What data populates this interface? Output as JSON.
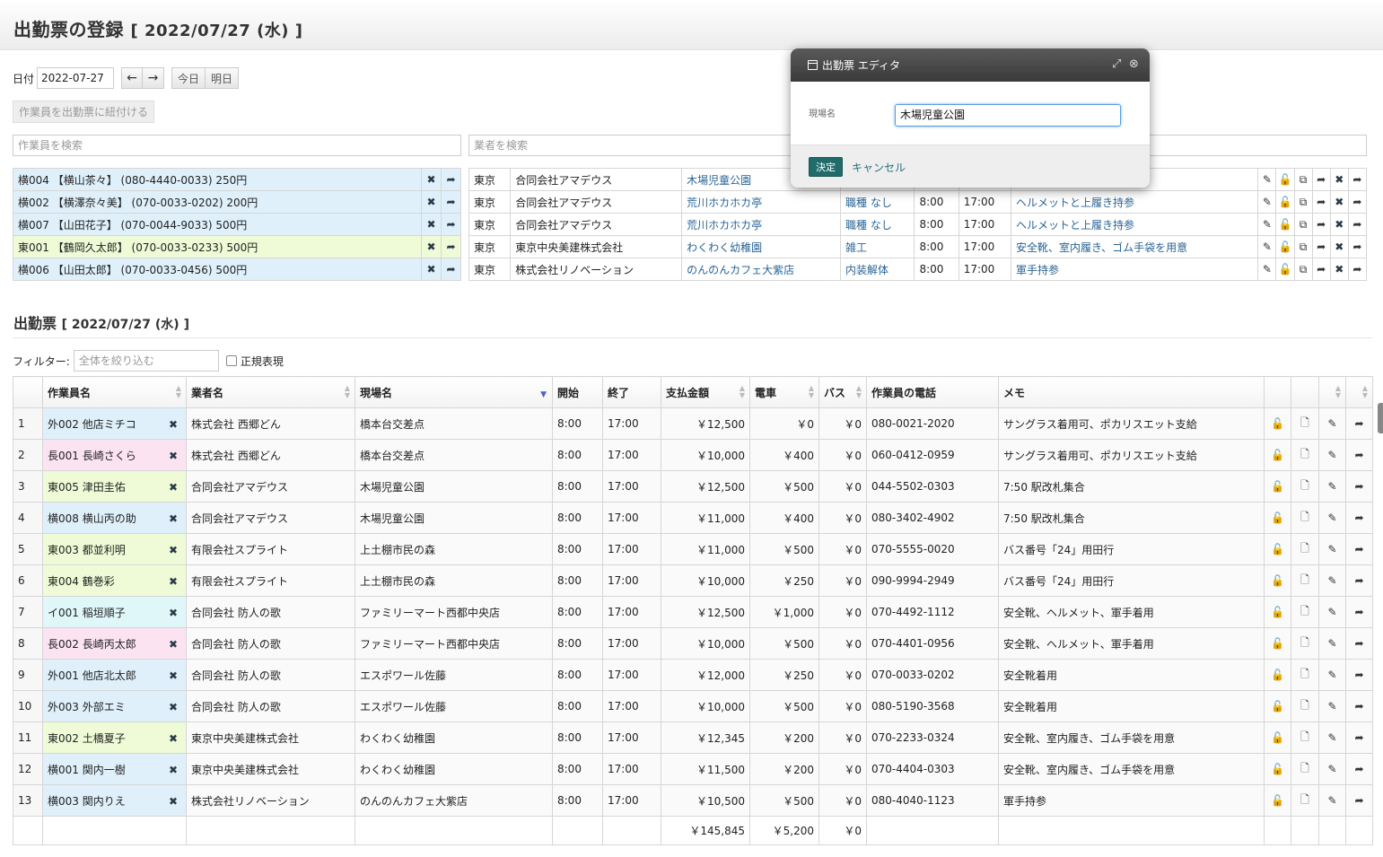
{
  "page": {
    "title": "出勤票の登録",
    "title_date": "[ 2022/07/27 (水) ]"
  },
  "date_nav": {
    "label": "日付",
    "value": "2022-07-27",
    "prev_icon": "←",
    "next_icon": "→",
    "today": "今日",
    "tomorrow": "明日"
  },
  "link_button": "作業員を出勤票に紐付ける",
  "search": {
    "workers_placeholder": "作業員を検索",
    "vendors_placeholder": "業者を検索"
  },
  "worker_list": [
    {
      "text": "横004 【横山茶々】 (080-4440-0033) 250円",
      "color": "#dff0fb"
    },
    {
      "text": "横002 【横澤奈々美】 (070-0033-0202) 200円",
      "color": "#dff0fb"
    },
    {
      "text": "横007 【山田花子】 (070-0044-9033) 500円",
      "color": "#dff0fb"
    },
    {
      "text": "東001 【鶴岡久太郎】 (070-0033-0233) 500円",
      "color": "#eefbd6"
    },
    {
      "text": "横006 【山田太郎】 (070-0033-0456) 500円",
      "color": "#dff0fb"
    }
  ],
  "assignments": [
    {
      "area": "東京",
      "company": "合同会社アマデウス",
      "site": "木場児童公園",
      "job": "",
      "start": "",
      "end": "",
      "memo": ""
    },
    {
      "area": "東京",
      "company": "合同会社アマデウス",
      "site": "荒川ホカホカ亭",
      "job": "職種 なし",
      "start": "8:00",
      "end": "17:00",
      "memo": "ヘルメットと上履き持参"
    },
    {
      "area": "東京",
      "company": "合同会社アマデウス",
      "site": "荒川ホカホカ亭",
      "job": "職種 なし",
      "start": "8:00",
      "end": "17:00",
      "memo": "ヘルメットと上履き持参"
    },
    {
      "area": "東京",
      "company": "東京中央美建株式会社",
      "site": "わくわく幼稚園",
      "job": "雑工",
      "start": "8:00",
      "end": "17:00",
      "memo": "安全靴、室内履き、ゴム手袋を用意"
    },
    {
      "area": "東京",
      "company": "株式会社リノベーション",
      "site": "のんのんカフェ大紫店",
      "job": "内装解体",
      "start": "8:00",
      "end": "17:00",
      "memo": "軍手持参"
    }
  ],
  "section": {
    "title": "出勤票",
    "date": "[ 2022/07/27 (水) ]"
  },
  "filter": {
    "label": "フィルター:",
    "placeholder": "全体を絞り込む",
    "regex_label": "正規表現"
  },
  "table": {
    "headers": [
      "作業員名",
      "業者名",
      "現場名",
      "開始",
      "終了",
      "支払金額",
      "電車",
      "バス",
      "作業員の電話",
      "メモ"
    ],
    "rows": [
      {
        "no": "1",
        "worker": "外002 他店ミチコ",
        "worker_color": "blue",
        "company": "株式会社 西郷どん",
        "site": "橋本台交差点",
        "start": "8:00",
        "end": "17:00",
        "pay": "￥12,500",
        "train": "￥0",
        "bus": "￥0",
        "phone": "080-0021-2020",
        "memo": "サングラス着用可、ポカリスエット支給"
      },
      {
        "no": "2",
        "worker": "長001 長崎さくら",
        "worker_color": "pink",
        "company": "株式会社 西郷どん",
        "site": "橋本台交差点",
        "start": "8:00",
        "end": "17:00",
        "pay": "￥10,000",
        "train": "￥400",
        "bus": "￥0",
        "phone": "060-0412-0959",
        "memo": "サングラス着用可、ポカリスエット支給"
      },
      {
        "no": "3",
        "worker": "東005 津田圭佑",
        "worker_color": "green",
        "company": "合同会社アマデウス",
        "site": "木場児童公園",
        "start": "8:00",
        "end": "17:00",
        "pay": "￥12,500",
        "train": "￥500",
        "bus": "￥0",
        "phone": "044-5502-0303",
        "memo": "7:50 駅改札集合"
      },
      {
        "no": "4",
        "worker": "横008 横山丙の助",
        "worker_color": "blue",
        "company": "合同会社アマデウス",
        "site": "木場児童公園",
        "start": "8:00",
        "end": "17:00",
        "pay": "￥11,000",
        "train": "￥400",
        "bus": "￥0",
        "phone": "080-3402-4902",
        "memo": "7:50 駅改札集合"
      },
      {
        "no": "5",
        "worker": "東003 都並利明",
        "worker_color": "green",
        "company": "有限会社スプライト",
        "site": "上土棚市民の森",
        "start": "8:00",
        "end": "17:00",
        "pay": "￥11,000",
        "train": "￥500",
        "bus": "￥0",
        "phone": "070-5555-0020",
        "memo": "バス番号「24」用田行"
      },
      {
        "no": "6",
        "worker": "東004 鶴巻彩",
        "worker_color": "green",
        "company": "有限会社スプライト",
        "site": "上土棚市民の森",
        "start": "8:00",
        "end": "17:00",
        "pay": "￥10,000",
        "train": "￥250",
        "bus": "￥0",
        "phone": "090-9994-2949",
        "memo": "バス番号「24」用田行"
      },
      {
        "no": "7",
        "worker": "イ001 稲垣順子",
        "worker_color": "cyan",
        "company": "合同会社 防人の歌",
        "site": "ファミリーマート西都中央店",
        "start": "8:00",
        "end": "17:00",
        "pay": "￥12,500",
        "train": "￥1,000",
        "bus": "￥0",
        "phone": "070-4492-1112",
        "memo": "安全靴、ヘルメット、軍手着用"
      },
      {
        "no": "8",
        "worker": "長002 長崎丙太郎",
        "worker_color": "pink",
        "company": "合同会社 防人の歌",
        "site": "ファミリーマート西都中央店",
        "start": "8:00",
        "end": "17:00",
        "pay": "￥10,000",
        "train": "￥500",
        "bus": "￥0",
        "phone": "070-4401-0956",
        "memo": "安全靴、ヘルメット、軍手着用"
      },
      {
        "no": "9",
        "worker": "外001 他店北太郎",
        "worker_color": "blue",
        "company": "合同会社 防人の歌",
        "site": "エスポワール佐藤",
        "start": "8:00",
        "end": "17:00",
        "pay": "￥12,000",
        "train": "￥250",
        "bus": "￥0",
        "phone": "070-0033-0202",
        "memo": "安全靴着用"
      },
      {
        "no": "10",
        "worker": "外003 外部エミ",
        "worker_color": "blue",
        "company": "合同会社 防人の歌",
        "site": "エスポワール佐藤",
        "start": "8:00",
        "end": "17:00",
        "pay": "￥10,000",
        "train": "￥500",
        "bus": "￥0",
        "phone": "080-5190-3568",
        "memo": "安全靴着用"
      },
      {
        "no": "11",
        "worker": "東002 土橋夏子",
        "worker_color": "green",
        "company": "東京中央美建株式会社",
        "site": "わくわく幼稚園",
        "start": "8:00",
        "end": "17:00",
        "pay": "￥12,345",
        "train": "￥200",
        "bus": "￥0",
        "phone": "070-2233-0324",
        "memo": "安全靴、室内履き、ゴム手袋を用意"
      },
      {
        "no": "12",
        "worker": "横001 関内一樹",
        "worker_color": "blue",
        "company": "東京中央美建株式会社",
        "site": "わくわく幼稚園",
        "start": "8:00",
        "end": "17:00",
        "pay": "￥11,500",
        "train": "￥200",
        "bus": "￥0",
        "phone": "070-4404-0303",
        "memo": "安全靴、室内履き、ゴム手袋を用意"
      },
      {
        "no": "13",
        "worker": "横003 関内りえ",
        "worker_color": "blue",
        "company": "株式会社リノベーション",
        "site": "のんのんカフェ大紫店",
        "start": "8:00",
        "end": "17:00",
        "pay": "￥10,500",
        "train": "￥500",
        "bus": "￥0",
        "phone": "080-4040-1123",
        "memo": "軍手持参"
      }
    ],
    "totals": {
      "pay": "￥145,845",
      "train": "￥5,200",
      "bus": "￥0"
    }
  },
  "modal": {
    "title": "出勤票 エディタ",
    "field_label": "現場名",
    "field_value": "木場児童公園",
    "ok": "決定",
    "cancel": "キャンセル",
    "expand_icon": "⤢",
    "close_icon": "⊗"
  },
  "icons": {
    "remove": "✖",
    "forward": "➦",
    "edit": "✎",
    "unlock": "🔓",
    "copy": "⧉",
    "document": "🗋"
  }
}
